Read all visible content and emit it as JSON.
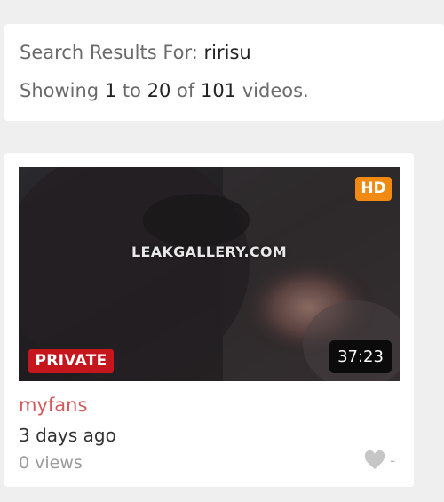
{
  "search": {
    "prefix": "Search Results For: ",
    "query": "ririsu",
    "showing_word": "Showing ",
    "from": "1",
    "to_word": " to ",
    "to": "20",
    "of_word": " of ",
    "total": "101",
    "suffix": " videos."
  },
  "video": {
    "hd_label": "HD",
    "watermark": "LEAKGALLERY.COM",
    "private_label": "PRIVATE",
    "duration": "37:23",
    "channel": "myfans",
    "time_ago": "3 days ago",
    "views": "0 views",
    "likes": "-",
    "like_icon": "heart-icon"
  },
  "colors": {
    "hd_badge": "#f08a12",
    "private_badge": "#c4161c",
    "channel_link": "#d4575a"
  }
}
